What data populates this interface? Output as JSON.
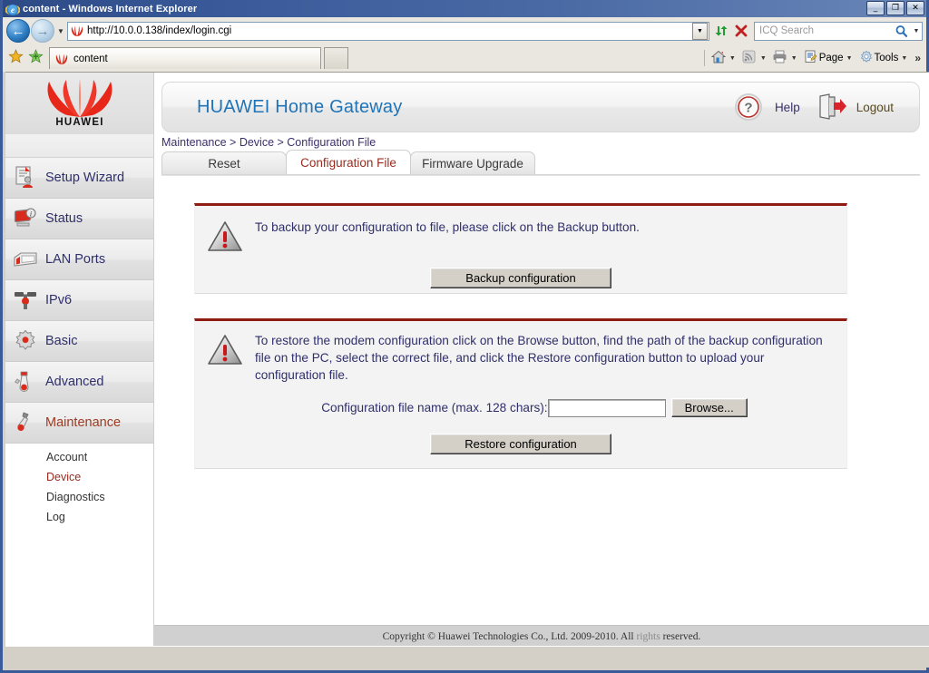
{
  "browser": {
    "title": "content - Windows Internet Explorer",
    "title_icon": "ie-logo-icon",
    "window_buttons": [
      {
        "name": "minimize-button",
        "glyph": "_"
      },
      {
        "name": "restore-button",
        "glyph": "❐"
      },
      {
        "name": "close-button",
        "glyph": "✕"
      }
    ],
    "back_glyph": "←",
    "forward_glyph": "→",
    "history_glyph": "▼",
    "address": {
      "url": "http://10.0.0.138/index/login.cgi",
      "favicon": "huawei-favicon",
      "dropdown_glyph": "▼"
    },
    "refresh_glyph": "↻",
    "stop_glyph": "✕",
    "search": {
      "placeholder": "ICQ Search",
      "value": "",
      "go_glyph": "⚲",
      "drop_glyph": "▼"
    },
    "favorites_glyph": "★",
    "add_favorite_glyph": "★",
    "tab": {
      "label": "content",
      "favicon": "huawei-favicon"
    },
    "new_tab_label": "",
    "toolbar": [
      {
        "name": "home-button",
        "icon": "home-icon",
        "label": "",
        "arrow": "▼"
      },
      {
        "name": "feeds-button",
        "icon": "rss-icon",
        "label": "",
        "arrow": "▼"
      },
      {
        "name": "print-button",
        "icon": "printer-icon",
        "label": "",
        "arrow": "▼"
      },
      {
        "name": "page-menu-button",
        "icon": "page-icon",
        "label": "Page",
        "arrow": "▼"
      },
      {
        "name": "tools-menu-button",
        "icon": "gear-icon",
        "label": "Tools",
        "arrow": "▼"
      }
    ],
    "overflow_glyph": "»"
  },
  "sidebar": {
    "logo_text": "HUAWEI",
    "items": [
      {
        "label": "Setup Wizard",
        "icon": "setup-wizard-icon",
        "active": false
      },
      {
        "label": "Status",
        "icon": "status-icon",
        "active": false
      },
      {
        "label": "LAN Ports",
        "icon": "lan-ports-icon",
        "active": false
      },
      {
        "label": "IPv6",
        "icon": "ipv6-icon",
        "active": false
      },
      {
        "label": "Basic",
        "icon": "basic-gear-icon",
        "active": false
      },
      {
        "label": "Advanced",
        "icon": "advanced-icon",
        "active": false
      },
      {
        "label": "Maintenance",
        "icon": "maintenance-icon",
        "active": true
      }
    ],
    "sub_items": [
      {
        "label": "Account",
        "active": false
      },
      {
        "label": "Device",
        "active": true
      },
      {
        "label": "Diagnostics",
        "active": false
      },
      {
        "label": "Log",
        "active": false
      }
    ]
  },
  "header": {
    "title": "HUAWEI Home Gateway",
    "help_label": "Help",
    "help_icon": "help-question-icon",
    "logout_label": "Logout",
    "logout_icon": "logout-door-icon"
  },
  "breadcrumb": "Maintenance > Device > Configuration File",
  "tabs": [
    {
      "label": "Reset",
      "active": false
    },
    {
      "label": "Configuration File",
      "active": true
    },
    {
      "label": "Firmware Upgrade",
      "active": false
    }
  ],
  "backup_panel": {
    "icon": "warning-triangle-icon",
    "text": "To backup your configuration to file, please click on the Backup button.",
    "button_label": "Backup configuration"
  },
  "restore_panel": {
    "icon": "warning-triangle-icon",
    "text": "To restore the modem configuration click on the Browse button, find the path of the backup configuration file on the PC, select the correct file, and click the Restore configuration button to upload your configuration file.",
    "field_label": "Configuration file name (max. 128 chars):",
    "field_value": "",
    "field_placeholder": "",
    "browse_label": "Browse...",
    "button_label": "Restore configuration"
  },
  "footer": {
    "text_main": "Copyright © Huawei Technologies Co., Ltd. 2009-2010. All ",
    "text_sub": "rights",
    "text_end": " reserved."
  },
  "colors": {
    "brand_red": "#8f1c12",
    "title_blue": "#1f74b8",
    "active_tab_text": "#9a2b1e",
    "link_purple": "#2f2f6b",
    "titlebar_blue": "#3a5a9a"
  }
}
